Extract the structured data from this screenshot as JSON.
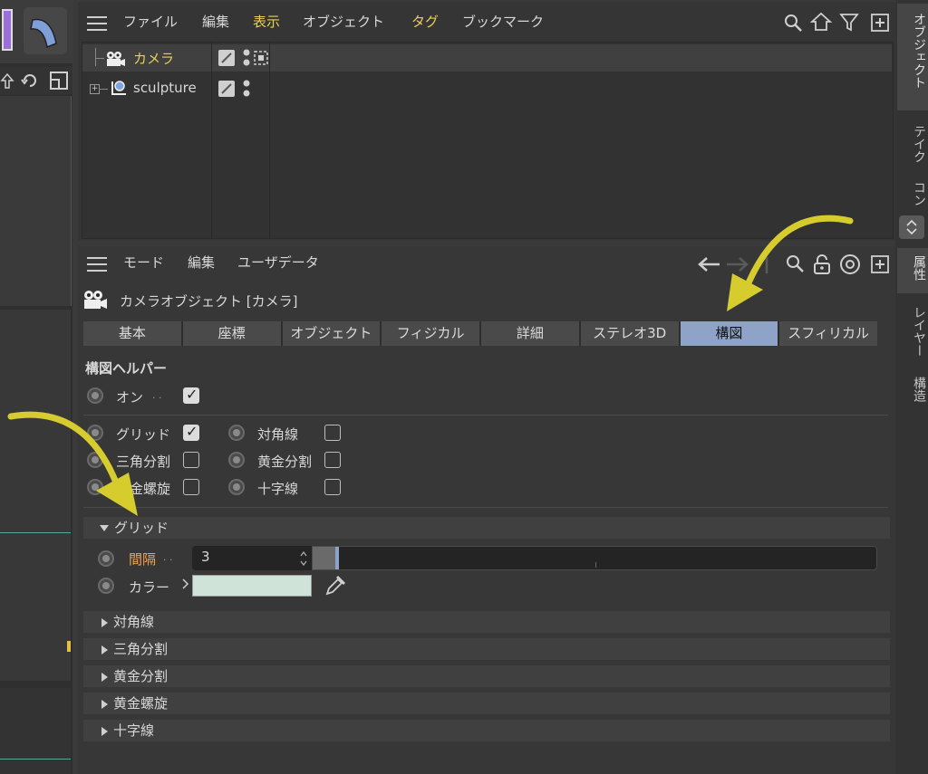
{
  "object_manager": {
    "menu": [
      "ファイル",
      "編集",
      "表示",
      "オブジェクト",
      "タグ",
      "ブックマーク"
    ],
    "highlight_menu": [
      "表示",
      "タグ"
    ],
    "objects": [
      {
        "name": "カメラ",
        "active": true
      },
      {
        "name": "sculpture",
        "active": false
      }
    ]
  },
  "right_tabs": {
    "top": [
      "オブジェクト",
      "テイク",
      "コン"
    ],
    "bottom": [
      "属性",
      "レイヤー",
      "構造"
    ]
  },
  "attribute_manager": {
    "menu": [
      "モード",
      "編集",
      "ユーザデータ"
    ],
    "object_title": "カメラオブジェクト [カメラ]",
    "tabs": [
      "基本",
      "座標",
      "オブジェクト",
      "フィジカル",
      "詳細",
      "ステレオ3D",
      "構図",
      "スフィリカル"
    ],
    "active_tab": "構図",
    "group_title": "構図ヘルパー",
    "enable_label": "オン",
    "enable_dots": ". .",
    "enable_checked": true,
    "options": [
      {
        "label": "グリッド",
        "checked": true
      },
      {
        "label": "対角線",
        "checked": false
      },
      {
        "label": "三角分割",
        "checked": false
      },
      {
        "label": "黄金分割",
        "checked": false
      },
      {
        "label": "黄金螺旋",
        "checked": false
      },
      {
        "label": "十字線",
        "checked": false
      }
    ],
    "grid_section": {
      "title": "グリッド",
      "spacing_label": "間隔",
      "spacing_dots": ". .",
      "spacing_value": "3",
      "slider_fraction": 0.04,
      "color_label": "カラー",
      "color_value": "#cfe3d8"
    },
    "collapsed_sections": [
      "対角線",
      "三角分割",
      "黄金分割",
      "黄金螺旋",
      "十字線"
    ]
  },
  "colors": {
    "accent_yellow": "#e8cf55",
    "label_orange": "#f0a34a",
    "active_tab": "#8fa3c9",
    "arrow": "#d7cc2e"
  }
}
